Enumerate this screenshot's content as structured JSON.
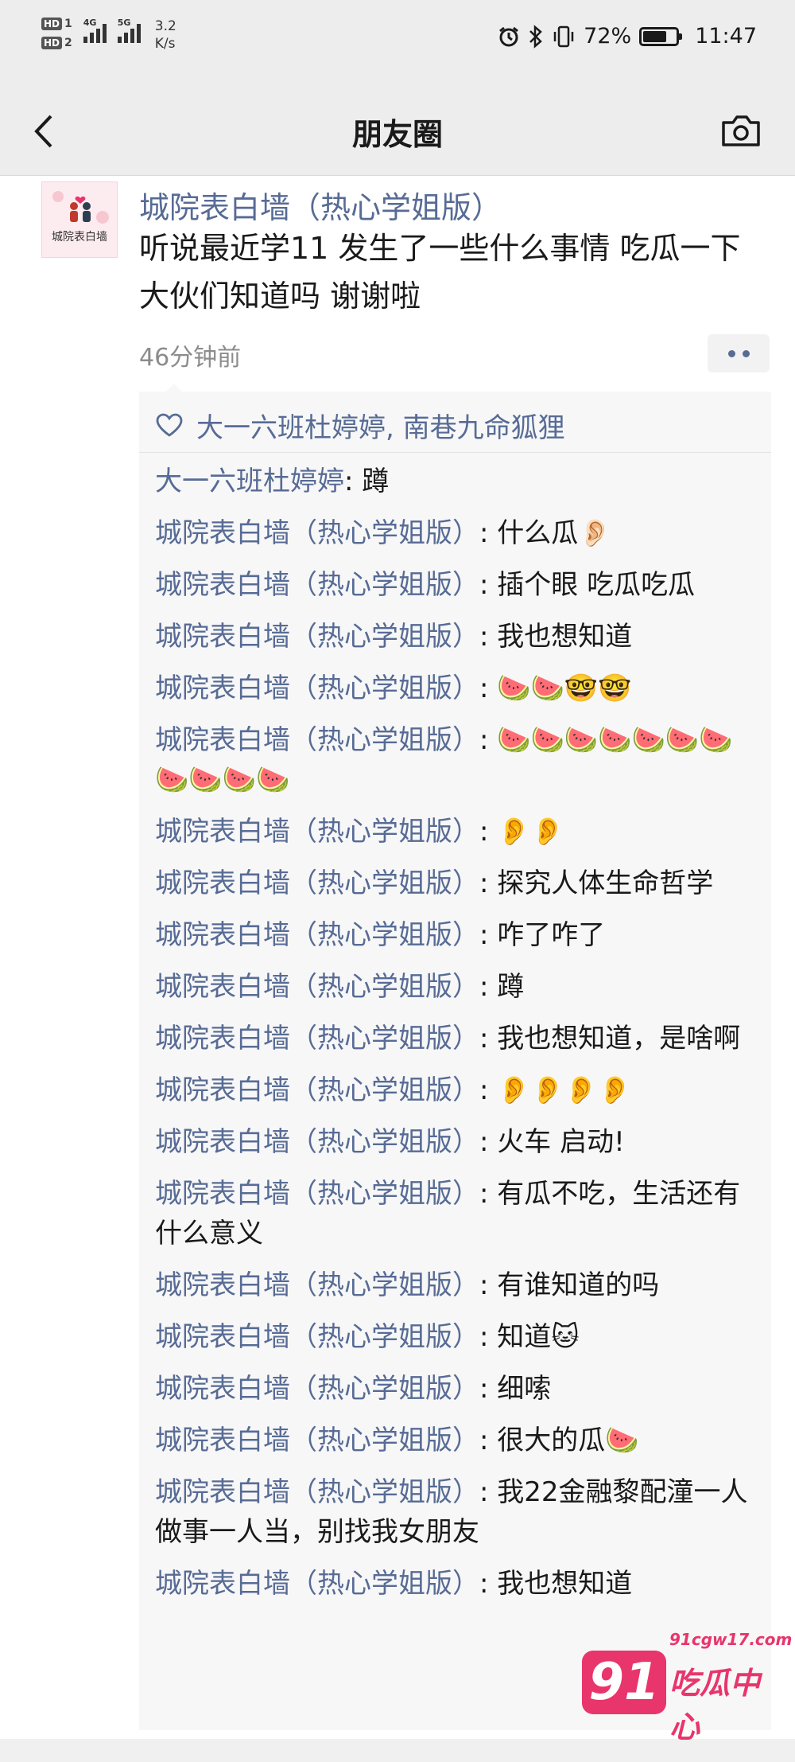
{
  "status_bar": {
    "hd_labels": [
      "HD",
      "HD"
    ],
    "hd_slots": [
      "1",
      "2"
    ],
    "network_1": "4G",
    "network_2": "5G",
    "speed_value": "3.2",
    "speed_unit": "K/s",
    "alarm_icon": "alarm-icon",
    "bluetooth_icon": "bluetooth-icon",
    "vibrate_icon": "vibrate-icon",
    "battery_percent": "72%",
    "battery_level": 0.72,
    "time": "11:47"
  },
  "nav": {
    "title": "朋友圈",
    "back_icon": "chevron-left-icon",
    "camera_icon": "camera-icon"
  },
  "post": {
    "author": "城院表白墙（热心学姐版）",
    "avatar_text": "城院表白墙",
    "text": "听说最近学11 发生了一些什么事情  吃瓜一下  大伙们知道吗  谢谢啦",
    "timestamp": "46分钟前"
  },
  "likes": {
    "text": "大一六班杜婷婷, 南巷九命狐狸"
  },
  "comments": [
    {
      "name": "大一六班杜婷婷",
      "text": ": 蹲"
    },
    {
      "name": "城院表白墙（热心学姐版）",
      "text": ": 什么瓜👂🏻"
    },
    {
      "name": "城院表白墙（热心学姐版）",
      "text": ": 插个眼 吃瓜吃瓜"
    },
    {
      "name": "城院表白墙（热心学姐版）",
      "text": ": 我也想知道"
    },
    {
      "name": "城院表白墙（热心学姐版）",
      "text": ": 🍉🍉🤓🤓"
    },
    {
      "name": "城院表白墙（热心学姐版）",
      "text": ": 🍉🍉🍉🍉🍉🍉🍉🍉🍉🍉🍉"
    },
    {
      "name": "城院表白墙（热心学姐版）",
      "text": ": 👂👂"
    },
    {
      "name": "城院表白墙（热心学姐版）",
      "text": ": 探究人体生命哲学"
    },
    {
      "name": "城院表白墙（热心学姐版）",
      "text": ": 咋了咋了"
    },
    {
      "name": "城院表白墙（热心学姐版）",
      "text": ": 蹲"
    },
    {
      "name": "城院表白墙（热心学姐版）",
      "text": ": 我也想知道，是啥啊"
    },
    {
      "name": "城院表白墙（热心学姐版）",
      "text": ": 👂👂👂👂"
    },
    {
      "name": "城院表白墙（热心学姐版）",
      "text": ": 火车 启动!"
    },
    {
      "name": "城院表白墙（热心学姐版）",
      "text": ": 有瓜不吃，生活还有什么意义"
    },
    {
      "name": "城院表白墙（热心学姐版）",
      "text": ": 有谁知道的吗"
    },
    {
      "name": "城院表白墙（热心学姐版）",
      "text": ": 知道🐱"
    },
    {
      "name": "城院表白墙（热心学姐版）",
      "text": ": 细嗦"
    },
    {
      "name": "城院表白墙（热心学姐版）",
      "text": ": 很大的瓜🍉"
    },
    {
      "name": "城院表白墙（热心学姐版）",
      "text": ": 我22金融黎配潼一人做事一人当，别找我女朋友"
    },
    {
      "name": "城院表白墙（热心学姐版）",
      "text": ": 我也想知道"
    }
  ],
  "watermark": {
    "url": "91cgw17.com",
    "logo": "91",
    "text": "吃瓜中心"
  },
  "colors": {
    "link_blue": "#576b95",
    "bar_gray": "#ededed",
    "watermark_pink": "#e8356c"
  }
}
